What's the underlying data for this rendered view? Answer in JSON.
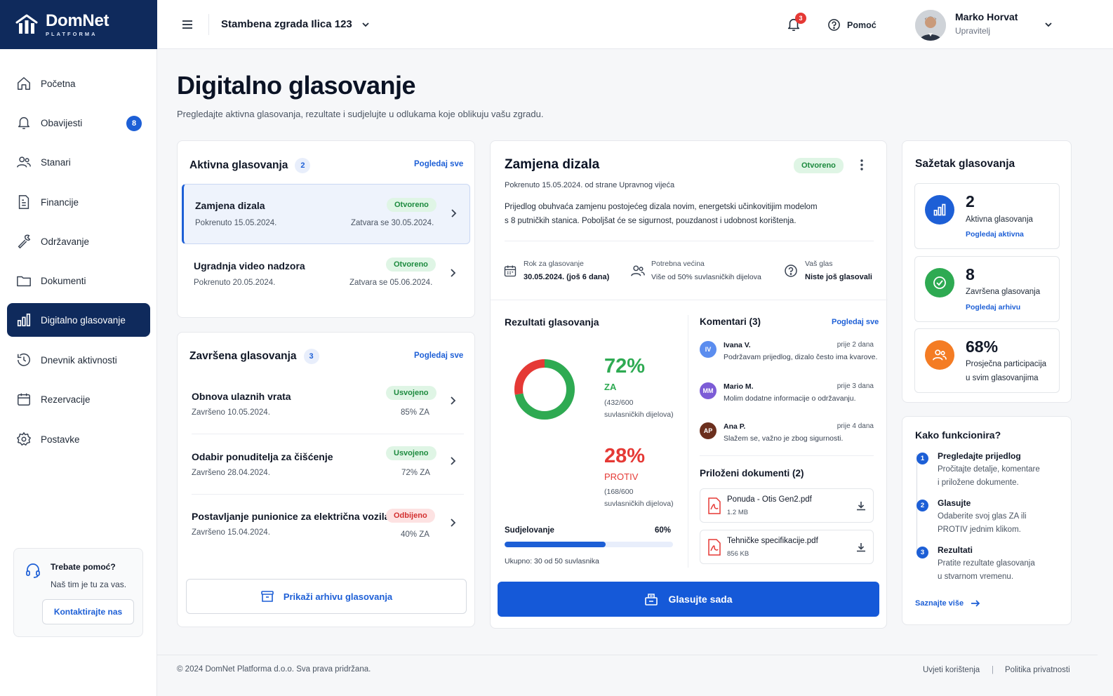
{
  "brand": {
    "name": "DomNet",
    "sub": "PLATFORMA"
  },
  "sidebar": {
    "items": [
      {
        "label": "Početna"
      },
      {
        "label": "Obavijesti",
        "badge": "8"
      },
      {
        "label": "Stanari"
      },
      {
        "label": "Financije"
      },
      {
        "label": "Održavanje"
      },
      {
        "label": "Dokumenti"
      },
      {
        "label": "Digitalno glasovanje"
      },
      {
        "label": "Dnevnik aktivnosti"
      },
      {
        "label": "Rezervacije"
      },
      {
        "label": "Postavke"
      }
    ],
    "help": {
      "title": "Trebate pomoć?",
      "text": "Naš tim je tu za vas.",
      "button": "Kontaktirajte nas"
    }
  },
  "topbar": {
    "building": "Stambena zgrada Ilica 123",
    "notif_count": "3",
    "help": "Pomoć",
    "user": {
      "name": "Marko Horvat",
      "role": "Upravitelj"
    }
  },
  "page": {
    "title": "Digitalno glasovanje",
    "subtitle": "Pregledajte aktivna glasovanja, rezultate i sudjelujte u odlukama koje oblikuju vašu zgradu."
  },
  "active": {
    "title": "Aktivna glasovanja",
    "count": "2",
    "link": "Pogledaj sve",
    "items": [
      {
        "title": "Zamjena dizala",
        "status": "Otvoreno",
        "started": "Pokrenuto 15.05.2024.",
        "closes": "Zatvara se 30.05.2024."
      },
      {
        "title": "Ugradnja video nadzora",
        "status": "Otvoreno",
        "started": "Pokrenuto 20.05.2024.",
        "closes": "Zatvara se 05.06.2024."
      }
    ]
  },
  "completed": {
    "title": "Završena glasovanja",
    "count": "3",
    "link": "Pogledaj sve",
    "items": [
      {
        "title": "Obnova ulaznih vrata",
        "status": "Usvojeno",
        "date": "Završeno 10.05.2024.",
        "result": "85% ZA"
      },
      {
        "title": "Odabir ponuditelja za čišćenje",
        "status": "Usvojeno",
        "date": "Završeno 28.04.2024.",
        "result": "72% ZA"
      },
      {
        "title": "Postavljanje punionice za električna vozila",
        "status": "Odbijeno",
        "date": "Završeno 15.04.2024.",
        "result": "40% ZA"
      }
    ],
    "archive_button": "Prikaži arhivu glasovanja"
  },
  "detail": {
    "title": "Zamjena dizala",
    "status": "Otvoreno",
    "meta": "Pokrenuto 15.05.2024. od strane Upravnog vijeća",
    "desc1": "Prijedlog obuhvaća zamjenu postojećeg dizala novim, energetski učinkovitijim modelom",
    "desc2": "s 8 putničkih stanica. Poboljšat će se sigurnost, pouzdanost i udobnost korištenja.",
    "facts": [
      {
        "label": "Rok za glasovanje",
        "value": "30.05.2024. (još 6 dana)"
      },
      {
        "label": "Potrebna većina",
        "value": "Više od 50% suvlasničkih dijelova"
      },
      {
        "label": "Vaš glas",
        "value": "Niste još glasovali"
      }
    ],
    "results": {
      "title": "Rezultati glasovanja",
      "za": {
        "pct": "72%",
        "label": "ZA",
        "count": "(432/600",
        "unit": "suvlasničkih dijelova)",
        "value": 72
      },
      "protiv": {
        "pct": "28%",
        "label": "PROTIV",
        "count": "(168/600",
        "unit": "suvlasničkih dijelova)",
        "value": 28
      },
      "participation_label": "Sudjelovanje",
      "participation_pct": "60%",
      "participation_value": 60,
      "total": "Ukupno: 30 od 50 suvlasnika"
    },
    "comments": {
      "title": "Komentari (3)",
      "link": "Pogledaj sve",
      "items": [
        {
          "initials": "IV",
          "name": "Ivana V.",
          "time": "prije 2 dana",
          "text": "Podržavam prijedlog, dizalo često ima kvarove.",
          "color": "#5b8def"
        },
        {
          "initials": "MM",
          "name": "Mario M.",
          "time": "prije 3 dana",
          "text": "Molim dodatne informacije o održavanju.",
          "color": "#7c5cd6"
        },
        {
          "initials": "AP",
          "name": "Ana P.",
          "time": "prije 4 dana",
          "text": "Slažem se, važno je zbog sigurnosti.",
          "color": "#6b2f1e"
        }
      ]
    },
    "documents": {
      "title": "Priloženi dokumenti (2)",
      "items": [
        {
          "name": "Ponuda - Otis Gen2.pdf",
          "size": "1.2 MB"
        },
        {
          "name": "Tehničke specifikacije.pdf",
          "size": "856 KB"
        }
      ]
    },
    "vote_button": "Glasujte sada"
  },
  "summary": {
    "title": "Sažetak glasovanja",
    "items": [
      {
        "value": "2",
        "label": "Aktivna glasovanja",
        "link": "Pogledaj aktivna",
        "color": "#1d5fd6"
      },
      {
        "value": "8",
        "label": "Završena glasovanja",
        "link": "Pogledaj arhivu",
        "color": "#2eaa52"
      },
      {
        "value": "68%",
        "label": "Prosječna participacija",
        "label2": "u svim glasovanjima",
        "color": "#f47c24"
      }
    ]
  },
  "how": {
    "title": "Kako funkcionira?",
    "steps": [
      {
        "num": "1",
        "title": "Pregledajte prijedlog",
        "line1": "Pročitajte detalje, komentare",
        "line2": "i priložene dokumente."
      },
      {
        "num": "2",
        "title": "Glasujte",
        "line1": "Odaberite svoj glas ZA ili",
        "line2": "PROTIV jednim klikom."
      },
      {
        "num": "3",
        "title": "Rezultati",
        "line1": "Pratite rezultate glasovanja",
        "line2": "u stvarnom vremenu."
      }
    ],
    "link": "Saznajte više"
  },
  "footer": {
    "copyright": "© 2024 DomNet Platforma d.o.o. Sva prava pridržana.",
    "terms": "Uvjeti korištenja",
    "privacy": "Politika privatnosti"
  },
  "colors": {
    "navy": "#0f2a5c",
    "accent": "#1d5fd6",
    "green": "#2eaa52",
    "red": "#e53935",
    "orange": "#f47c24"
  }
}
